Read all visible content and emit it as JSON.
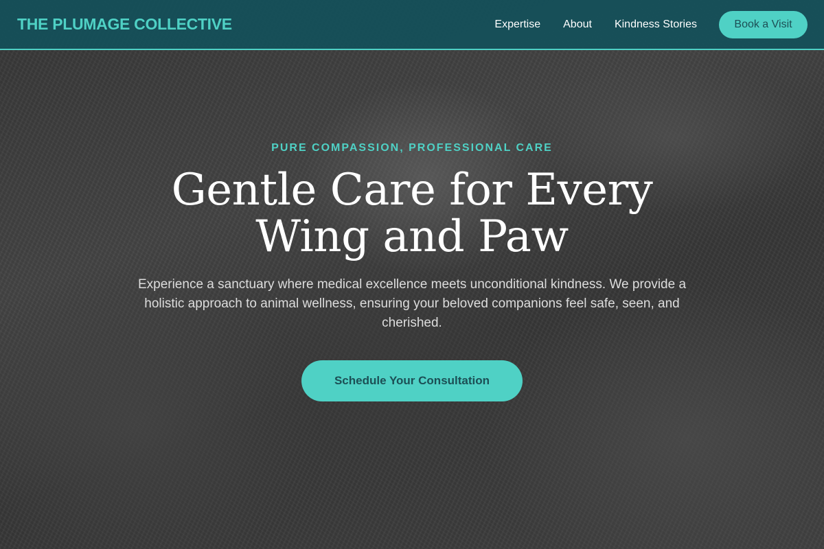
{
  "brand": {
    "name": "THE PLUMAGE COLLECTIVE"
  },
  "nav": {
    "items": [
      {
        "label": "Expertise"
      },
      {
        "label": "About"
      },
      {
        "label": "Kindness Stories"
      }
    ],
    "book_label": "Book a Visit"
  },
  "hero": {
    "eyebrow": "PURE COMPASSION, PROFESSIONAL CARE",
    "headline": "Gentle Care for Every Wing and Paw",
    "subtext": "Experience a sanctuary where medical excellence meets unconditional kindness. We provide a holistic approach to animal wellness, ensuring your beloved companions feel safe, seen, and cherished.",
    "cta_label": "Schedule Your Consultation"
  },
  "colors": {
    "accent": "#4fd1c5",
    "header_bg": "#14505a",
    "button_text": "#1c4f55"
  }
}
